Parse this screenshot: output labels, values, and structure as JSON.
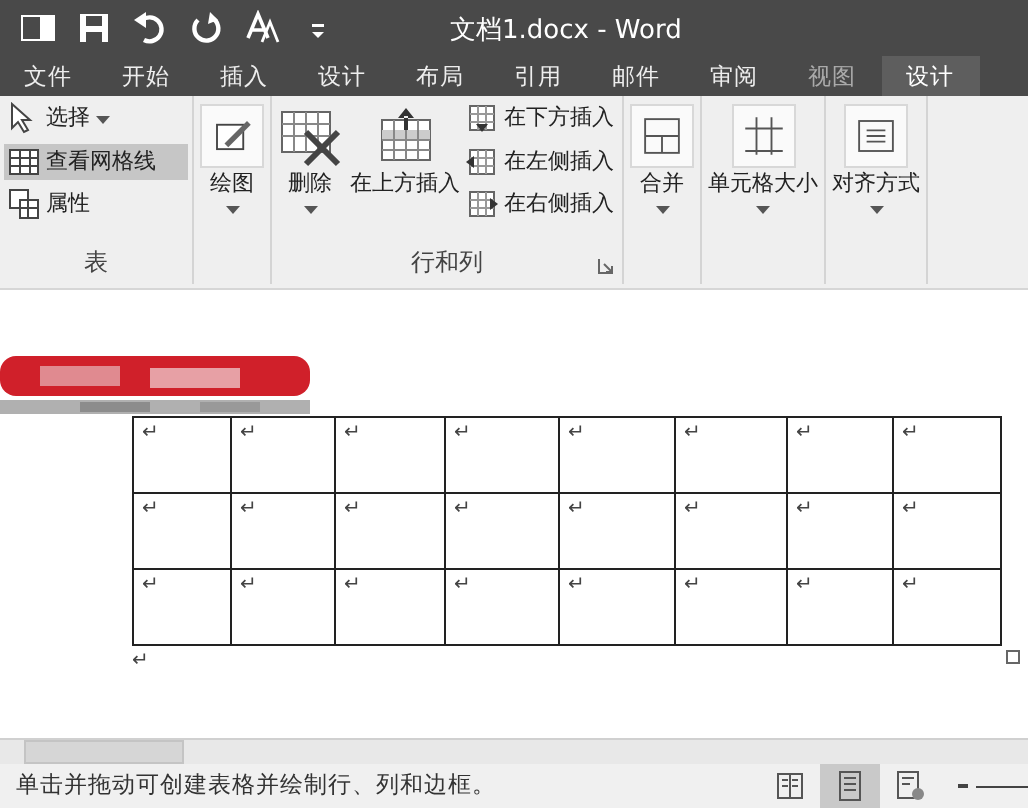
{
  "window": {
    "title": "文档1.docx - Word"
  },
  "tabs": [
    {
      "label": "文件",
      "selected": false,
      "dim": false
    },
    {
      "label": "开始",
      "selected": false,
      "dim": false
    },
    {
      "label": "插入",
      "selected": false,
      "dim": false
    },
    {
      "label": "设计",
      "selected": false,
      "dim": false
    },
    {
      "label": "布局",
      "selected": false,
      "dim": false
    },
    {
      "label": "引用",
      "selected": false,
      "dim": false
    },
    {
      "label": "邮件",
      "selected": false,
      "dim": false
    },
    {
      "label": "审阅",
      "selected": false,
      "dim": false
    },
    {
      "label": "视图",
      "selected": false,
      "dim": true
    },
    {
      "label": "设计",
      "selected": true,
      "dim": false
    }
  ],
  "ribbon": {
    "table_group": {
      "label": "表",
      "items": [
        {
          "label": "选择",
          "dropdown": true,
          "on": false
        },
        {
          "label": "查看网格线",
          "dropdown": false,
          "on": true
        },
        {
          "label": "属性",
          "dropdown": false,
          "on": false
        }
      ]
    },
    "draw": {
      "label": "绘图"
    },
    "delete": {
      "label": "删除"
    },
    "rows_group": {
      "label": "行和列",
      "insert_above": "在上方插入",
      "items": [
        {
          "label": "在下方插入"
        },
        {
          "label": "在左侧插入"
        },
        {
          "label": "在右侧插入"
        }
      ]
    },
    "more": [
      {
        "label": "合并"
      },
      {
        "label": "单元格大小"
      },
      {
        "label": "对齐方式"
      }
    ]
  },
  "table": {
    "rows": [
      [
        "↵",
        "↵",
        "↵",
        "↵",
        "↵",
        "↵",
        "↵",
        "↵"
      ],
      [
        "↵",
        "↵",
        "↵",
        "↵",
        "↵",
        "↵",
        "↵",
        "↵"
      ],
      [
        "↵",
        "↵",
        "↵",
        "↵",
        "↵",
        "↵",
        "↵",
        "↵"
      ]
    ],
    "after_mark": "↵"
  },
  "status_bar": {
    "text": "单击并拖动可创建表格并绘制行、列和边框。",
    "views": [
      {
        "selected": false
      },
      {
        "selected": true
      },
      {
        "selected": false
      }
    ]
  }
}
